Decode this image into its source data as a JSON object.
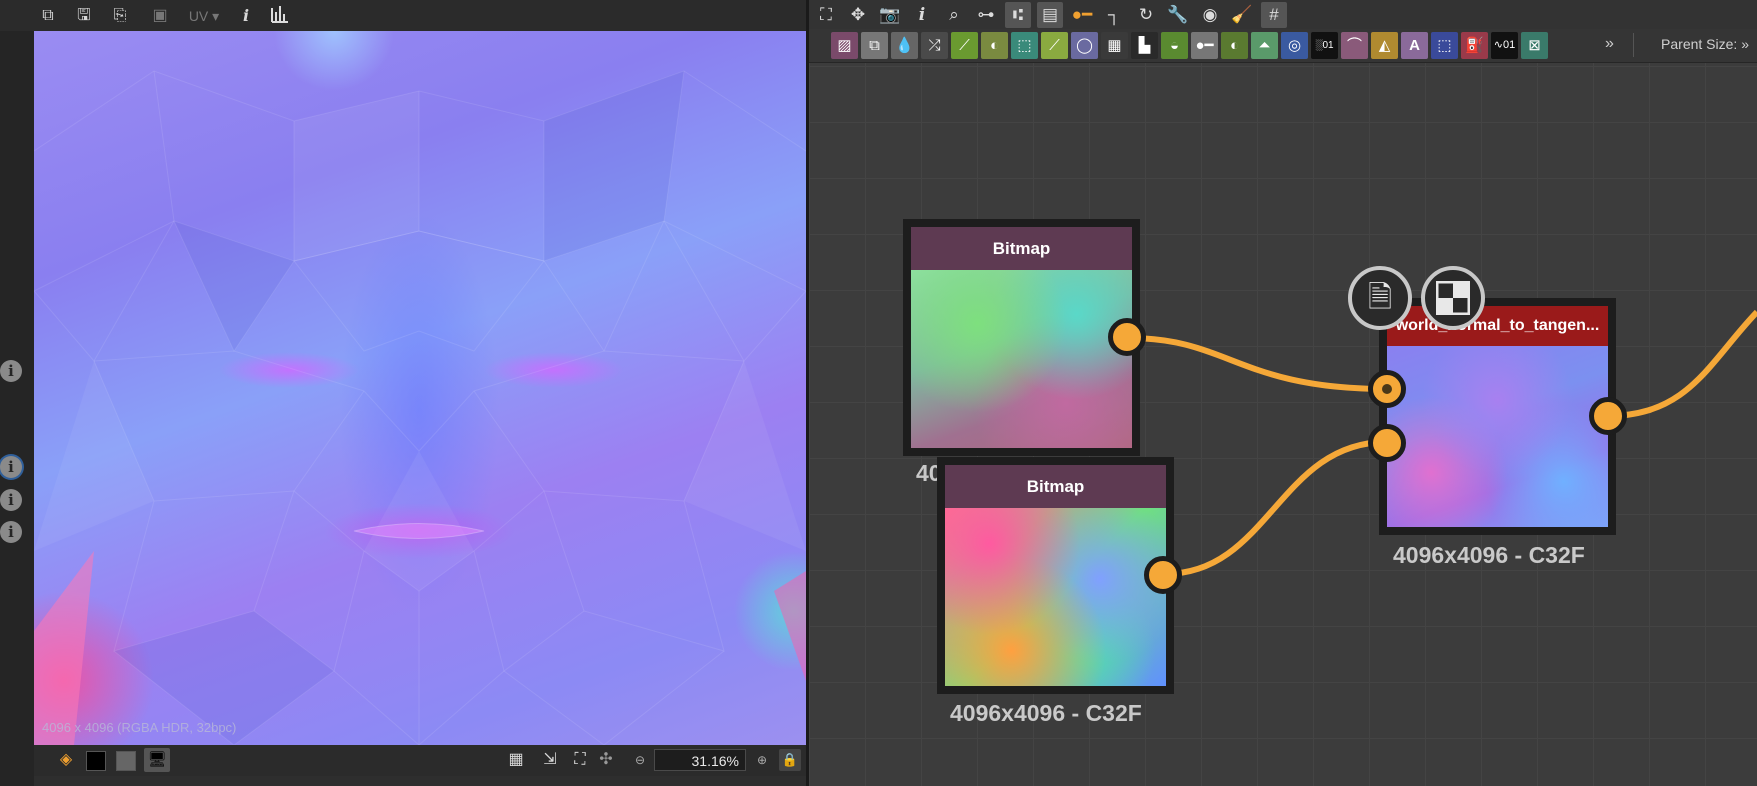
{
  "viewer": {
    "toolbar": {
      "uv_label": "UV"
    },
    "info_label": "4096 x 4096 (RGBA HDR, 32bpc)",
    "zoom": "31.16%"
  },
  "graph_toolbar": {
    "parent_size_label": "Parent Size:",
    "more_glyph": "»"
  },
  "nodes": [
    {
      "title": "Bitmap",
      "resolution": "4096x4096 - C32F",
      "title_color": "#5e3a52"
    },
    {
      "title": "Bitmap",
      "resolution": "4096x4096 - C32F",
      "title_color": "#5e3a52"
    },
    {
      "title": "world_normal_to_tangen...",
      "resolution": "4096x4096 - C32F",
      "title_color": "#9a1a1a"
    }
  ],
  "colors": {
    "connection": "#f5a838",
    "node_frame": "#1d1d1d",
    "graph_bg": "#3c3c3c"
  }
}
